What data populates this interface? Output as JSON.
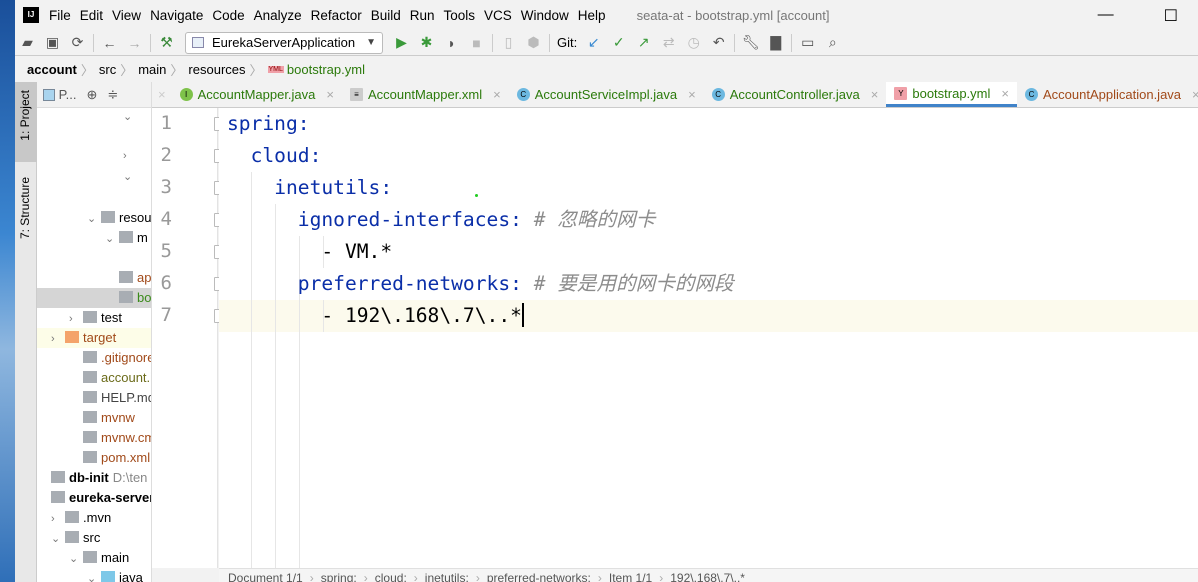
{
  "window": {
    "title": "seata-at - bootstrap.yml [account]",
    "logo": "IJ",
    "minimize": "—",
    "maximize": "☐"
  },
  "menu": [
    "File",
    "Edit",
    "View",
    "Navigate",
    "Code",
    "Analyze",
    "Refactor",
    "Build",
    "Run",
    "Tools",
    "VCS",
    "Window",
    "Help"
  ],
  "toolbar": {
    "run_config": "EurekaServerApplication",
    "git_label": "Git:"
  },
  "breadcrumb": [
    "account",
    "src",
    "main",
    "resources",
    "bootstrap.yml"
  ],
  "tool_windows": {
    "project": "1: Project",
    "structure": "7: Structure"
  },
  "project_panel": {
    "title": "P...",
    "items": [
      {
        "label": "resou",
        "kind": "folder",
        "chev": "⌄"
      },
      {
        "label": "m",
        "kind": "folder",
        "chev": "⌄"
      },
      {
        "label": "ap",
        "kind": "yml",
        "color": "#a14a1a"
      },
      {
        "label": "bo",
        "kind": "yml",
        "color": "#3a8a1a"
      },
      {
        "label": "test",
        "kind": "folder",
        "chev": "›"
      },
      {
        "label": "target",
        "kind": "folder-orange",
        "chev": "›",
        "color": "#a14a1a"
      },
      {
        "label": ".gitignore",
        "kind": "file",
        "color": "#a14a1a"
      },
      {
        "label": "account.iml",
        "kind": "file",
        "color": "#6b6b1a"
      },
      {
        "label": "HELP.md",
        "kind": "md",
        "color": "#444"
      },
      {
        "label": "mvnw",
        "kind": "file",
        "color": "#a14a1a"
      },
      {
        "label": "mvnw.cmd",
        "kind": "file",
        "color": "#a14a1a"
      },
      {
        "label": "pom.xml",
        "kind": "maven",
        "color": "#a14a1a"
      },
      {
        "label": "db-init",
        "kind": "module",
        "bold": true,
        "extra": "D:\\ten"
      },
      {
        "label": "eureka-server",
        "kind": "module",
        "bold": true
      },
      {
        "label": ".mvn",
        "kind": "folder",
        "chev": "›"
      },
      {
        "label": "src",
        "kind": "folder",
        "chev": "⌄"
      },
      {
        "label": "main",
        "kind": "folder",
        "chev": "⌄"
      },
      {
        "label": "java",
        "kind": "folder-blue",
        "chev": "⌄"
      }
    ]
  },
  "tabs": [
    {
      "label": "AccountMapper.java",
      "icon": "interface-icon",
      "color": "#2b7a0b"
    },
    {
      "label": "AccountMapper.xml",
      "icon": "xml-file-icon",
      "color": "#2b7a0b"
    },
    {
      "label": "AccountServiceImpl.java",
      "icon": "class-icon",
      "color": "#2b7a0b"
    },
    {
      "label": "AccountController.java",
      "icon": "class-icon",
      "color": "#2b7a0b"
    },
    {
      "label": "bootstrap.yml",
      "icon": "yml-file-icon",
      "color": "#2b7a0b",
      "active": true
    },
    {
      "label": "AccountApplication.java",
      "icon": "spring-class-icon",
      "color": "#a14a1a"
    }
  ],
  "editor": {
    "lines": [
      {
        "n": "1",
        "indent": "",
        "key": "spring:",
        "rest": "",
        "comment": ""
      },
      {
        "n": "2",
        "indent": "  ",
        "key": "cloud:",
        "rest": "",
        "comment": ""
      },
      {
        "n": "3",
        "indent": "    ",
        "key": "inetutils:",
        "rest": "",
        "comment": ""
      },
      {
        "n": "4",
        "indent": "      ",
        "key": "ignored-interfaces:",
        "rest": "",
        "comment": " # 忽略的网卡"
      },
      {
        "n": "5",
        "indent": "        ",
        "key": "",
        "rest": "- VM.*",
        "comment": ""
      },
      {
        "n": "6",
        "indent": "      ",
        "key": "preferred-networks:",
        "rest": "",
        "comment": " # 要是用的网卡的网段"
      },
      {
        "n": "7",
        "indent": "        ",
        "key": "",
        "rest": "- 192\\.168\\.7\\..*",
        "comment": ""
      }
    ]
  },
  "status_path": [
    "Document 1/1",
    "spring:",
    "cloud:",
    "inetutils:",
    "preferred-networks:",
    "Item 1/1",
    "192\\.168\\.7\\..*"
  ]
}
